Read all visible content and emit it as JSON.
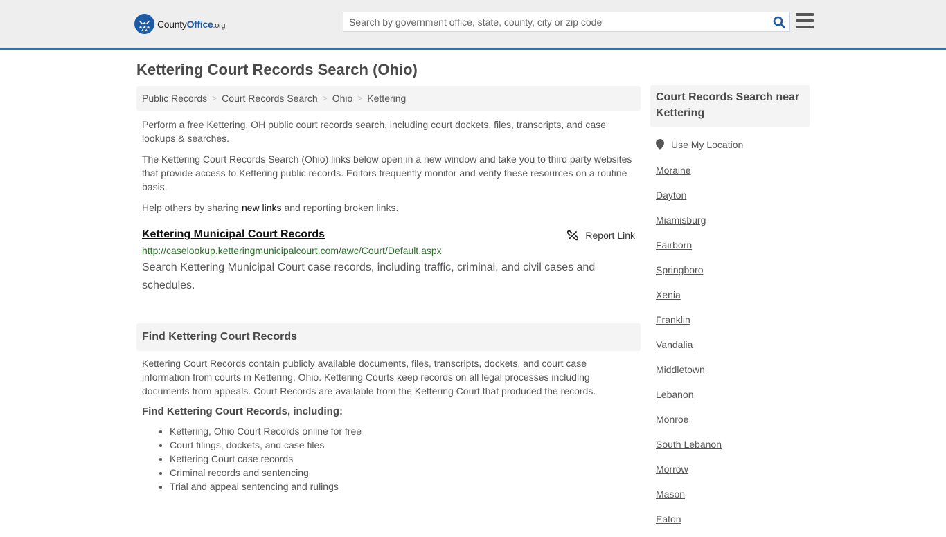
{
  "header": {
    "logo": {
      "county": "County",
      "office": "Office",
      "org": ".org",
      "icon": "eagle-stars-badge-icon"
    },
    "search": {
      "placeholder": "Search by government office, state, county, city or zip code",
      "value": "",
      "icon": "search-icon"
    },
    "menu_icon": "hamburger-menu-icon"
  },
  "colors": {
    "brand_blue": "#1d5aa5",
    "header_border": "#2f72b6",
    "url_green": "#2d6e2d",
    "panel_bg": "#f4f4f4"
  },
  "page": {
    "title": "Kettering Court Records Search (Ohio)"
  },
  "breadcrumb": [
    {
      "label": "Public Records"
    },
    {
      "label": "Court Records Search"
    },
    {
      "label": "Ohio"
    },
    {
      "label": "Kettering"
    }
  ],
  "intro": {
    "p1": "Perform a free Kettering, OH public court records search, including court dockets, files, transcripts, and case lookups & searches.",
    "p2": "The Kettering Court Records Search (Ohio) links below open in a new window and take you to third party websites that provide access to Kettering public records. Editors frequently monitor and verify these resources on a routine basis.",
    "p3_before": "Help others by sharing ",
    "p3_link": "new links",
    "p3_after": " and reporting broken links."
  },
  "record": {
    "title": "Kettering Municipal Court Records",
    "report_label": "Report Link",
    "report_icon": "broken-link-icon",
    "url": "http://caselookup.ketteringmunicipalcourt.com/awc/Court/Default.aspx",
    "description": "Search Kettering Municipal Court case records, including traffic, criminal, and civil cases and schedules."
  },
  "find_section": {
    "heading": "Find Kettering Court Records",
    "body": "Kettering Court Records contain publicly available documents, files, transcripts, dockets, and court case information from courts in Kettering, Ohio. Kettering Courts keep records on all legal processes including documents from appeals. Court Records are available from the Kettering Court that produced the records.",
    "subheading": "Find Kettering Court Records, including:",
    "items": [
      "Kettering, Ohio Court Records online for free",
      "Court filings, dockets, and case files",
      "Kettering Court case records",
      "Criminal records and sentencing",
      "Trial and appeal sentencing and rulings"
    ]
  },
  "sidebar": {
    "heading": "Court Records Search near Kettering",
    "use_location": "Use My Location",
    "location_icon": "map-pin-icon",
    "nearby": [
      "Moraine",
      "Dayton",
      "Miamisburg",
      "Fairborn",
      "Springboro",
      "Xenia",
      "Franklin",
      "Vandalia",
      "Middletown",
      "Lebanon",
      "Monroe",
      "South Lebanon",
      "Morrow",
      "Mason",
      "Eaton"
    ]
  }
}
